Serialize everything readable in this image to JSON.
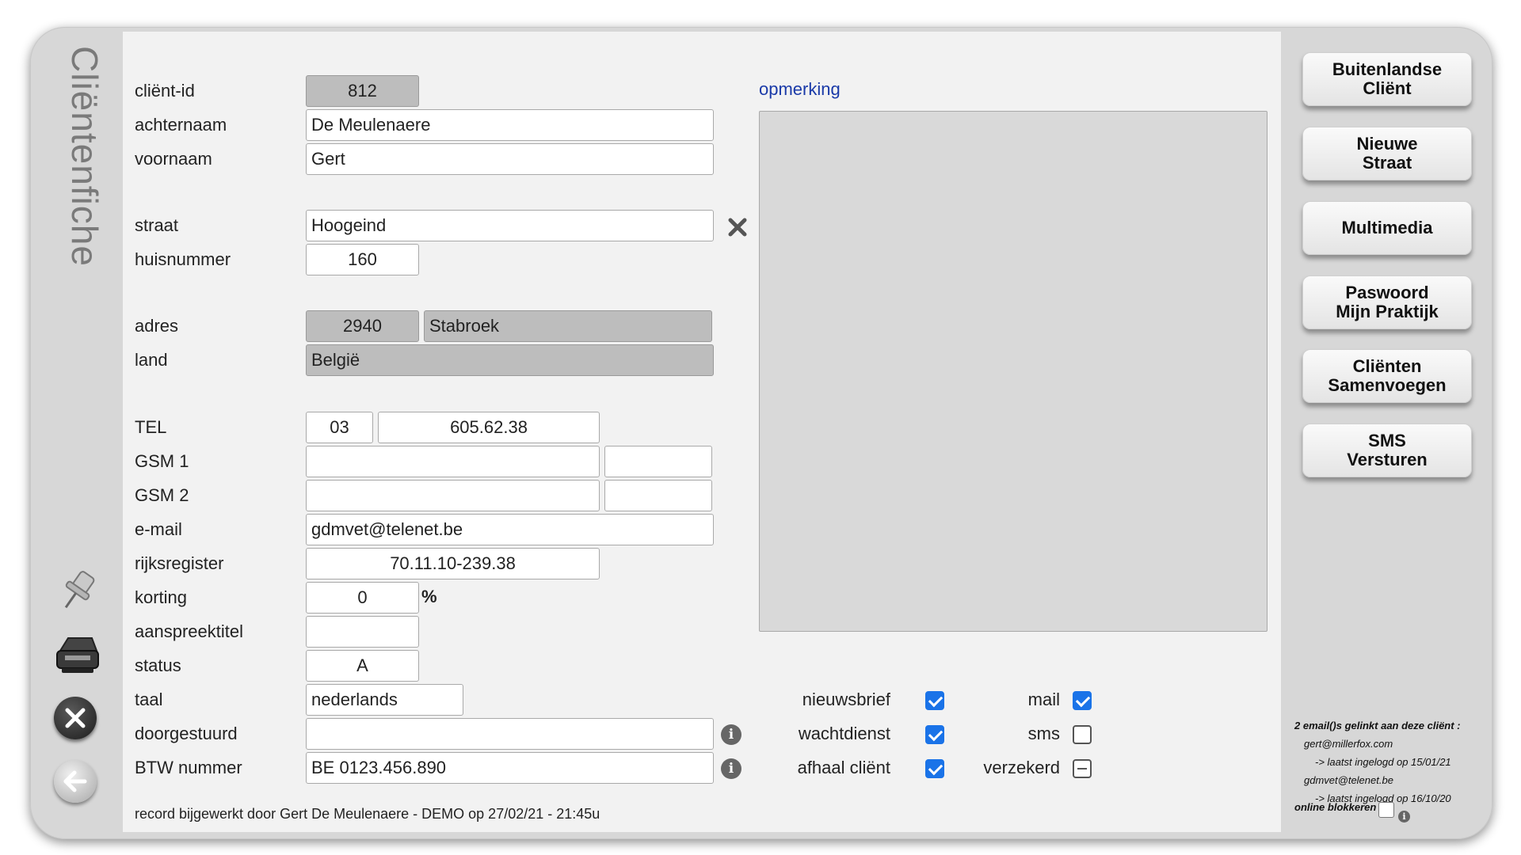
{
  "sidebar": {
    "title": "Cliëntenfiche"
  },
  "form": {
    "client_id": {
      "label": "cliënt-id",
      "value": "812"
    },
    "achternaam": {
      "label": "achternaam",
      "value": "De Meulenaere"
    },
    "voornaam": {
      "label": "voornaam",
      "value": "Gert"
    },
    "straat": {
      "label": "straat",
      "value": "Hoogeind"
    },
    "huisnummer": {
      "label": "huisnummer",
      "value": "160"
    },
    "adres": {
      "label": "adres",
      "postcode": "2940",
      "gemeente": "Stabroek"
    },
    "land": {
      "label": "land",
      "value": "België"
    },
    "tel": {
      "label": "TEL",
      "prefix": "03",
      "number": "605.62.38"
    },
    "gsm1": {
      "label": "GSM 1",
      "value": "",
      "extra": ""
    },
    "gsm2": {
      "label": "GSM 2",
      "value": "",
      "extra": ""
    },
    "email": {
      "label": "e-mail",
      "value": "gdmvet@telenet.be"
    },
    "rijksregister": {
      "label": "rijksregister",
      "value": "70.11.10-239.38"
    },
    "korting": {
      "label": "korting",
      "value": "0",
      "unit": "%"
    },
    "aanspreektitel": {
      "label": "aanspreektitel",
      "value": ""
    },
    "status": {
      "label": "status",
      "value": "A"
    },
    "taal": {
      "label": "taal",
      "value": "nederlands"
    },
    "doorgestuurd": {
      "label": "doorgestuurd",
      "value": ""
    },
    "btw": {
      "label": "BTW nummer",
      "value": "BE 0123.456.890"
    }
  },
  "memo": {
    "label": "opmerking",
    "value": ""
  },
  "checkboxes": {
    "nieuwsbrief": {
      "label": "nieuwsbrief",
      "checked": true
    },
    "wachtdienst": {
      "label": "wachtdienst",
      "checked": true
    },
    "afhaal": {
      "label": "afhaal cliënt",
      "checked": true
    },
    "mail": {
      "label": "mail",
      "checked": true
    },
    "sms": {
      "label": "sms",
      "checked": false
    },
    "verzekerd": {
      "label": "verzekerd",
      "state": "indeterminate"
    }
  },
  "footer": {
    "text": "record bijgewerkt door Gert De Meulenaere - DEMO op 27/02/21 - 21:45u"
  },
  "actions": {
    "buitenlandse": {
      "line1": "Buitenlandse",
      "line2": "Cliënt"
    },
    "nieuwe_straat": {
      "line1": "Nieuwe",
      "line2": "Straat"
    },
    "multimedia": {
      "line1": "Multimedia"
    },
    "paswoord": {
      "line1": "Paswoord",
      "line2": "Mijn Praktijk"
    },
    "samenvoegen": {
      "line1": "Cliënten",
      "line2": "Samenvoegen"
    },
    "sms": {
      "line1": "SMS",
      "line2": "Versturen"
    }
  },
  "online": {
    "header": "2 email()s gelinkt aan deze cliënt :",
    "email1": "gert@millerfox.com",
    "login1": "-> laatst ingelogd op 15/01/21",
    "email2": "gdmvet@telenet.be",
    "login2": "-> laatst ingelogd op 16/10/20",
    "block_label": "online blokkeren"
  },
  "icons": {
    "pin": "pushpin-icon",
    "printer": "printer-icon",
    "close": "close-icon",
    "back": "back-arrow-icon",
    "clear": "clear-x-icon",
    "info": "info-icon"
  }
}
